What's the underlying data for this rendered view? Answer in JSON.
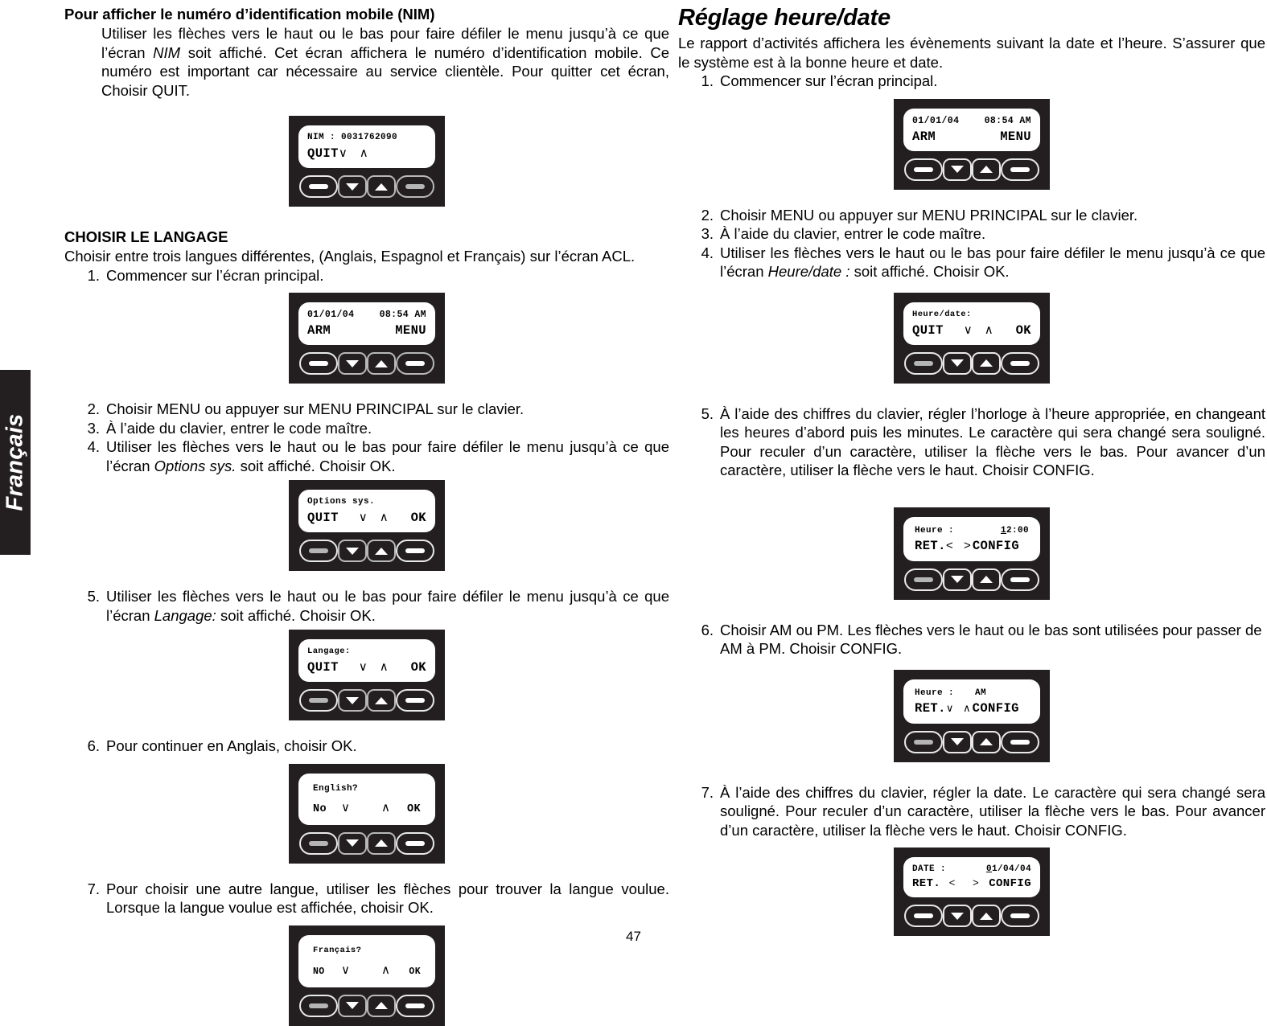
{
  "page": {
    "number": "47",
    "side_tab_label": "Français"
  },
  "left_column": {
    "section1": {
      "heading": "Pour afficher le numéro d’identification mobile (NIM)",
      "paragraph_part1": "Utiliser les flèches vers le haut ou le bas pour faire défiler le menu jusqu’à ce que l’écran ",
      "paragraph_italic": "NIM",
      "paragraph_part2": " soit affiché. Cet écran affichera le numéro d’identification mobile. Ce numéro est important car nécessaire au service clientèle. Pour quitter cet écran, Choisir QUIT."
    },
    "device_nim": {
      "line1_left": "NIM : 0031762090",
      "line1_right": "",
      "line2_left": "QUIT",
      "line2_arrows": "∨ ∧",
      "line2_right": "",
      "buttons": [
        "soft-left-button",
        "down-arrow-button",
        "up-arrow-button",
        "soft-right-button"
      ]
    },
    "section2": {
      "heading": "CHOISIR LE LANGAGE",
      "intro": "Choisir entre trois langues différentes, (Anglais, Espagnol et Français) sur l’écran ACL.",
      "steps": [
        {
          "num": "1.",
          "text": "Commencer sur l’écran principal."
        },
        {
          "num": "2.",
          "text": "Choisir MENU ou appuyer sur MENU PRINCIPAL sur le clavier."
        },
        {
          "num": "3.",
          "text": "À l’aide du clavier, entrer le code maître."
        },
        {
          "num": "4.",
          "pre": "Utiliser les flèches vers le haut ou le bas pour faire défiler le menu jusqu’à ce que l’écran ",
          "italic": "Options sys.",
          "post": " soit affiché. Choisir OK."
        },
        {
          "num": "5.",
          "pre": "Utiliser les flèches vers le haut ou le bas pour faire défiler le menu jusqu’à ce que l’écran ",
          "italic": "Langage:",
          "post": " soit affiché. Choisir OK."
        },
        {
          "num": "6.",
          "text": "Pour continuer en Anglais, choisir OK."
        },
        {
          "num": "7.",
          "text": "Pour choisir une autre langue, utiliser les flèches pour trouver la langue voulue. Lorsque la langue voulue est affichée, choisir OK."
        }
      ]
    },
    "device_main_screen": {
      "line1_left": "01/01/04",
      "line1_right": "08:54 AM",
      "line2_left": "ARM",
      "line2_right": "MENU"
    },
    "device_options_sys": {
      "line1_left": "Options sys.",
      "line2_left": "QUIT",
      "line2_arrows": "∨ ∧",
      "line2_right": "OK"
    },
    "device_langage": {
      "line1_left": "Langage:",
      "line2_left": "QUIT",
      "line2_arrows": "∨ ∧",
      "line2_right": "OK"
    },
    "device_english": {
      "line1_left": "English?",
      "line2_left": "No",
      "line2_arrows": "∨   ∧",
      "line2_right": "OK"
    },
    "device_francais": {
      "line1_left": "Français?",
      "line2_left": "NO",
      "line2_arrows": "∨   ∧",
      "line2_right": "OK"
    }
  },
  "right_column": {
    "title": "Réglage heure/date",
    "intro": "Le rapport d’activités affichera les évènements suivant la date et l’heure. S’assurer que le système est à la bonne heure et date.",
    "steps": [
      {
        "num": "1.",
        "text": "Commencer sur l’écran principal."
      },
      {
        "num": "2.",
        "text": "Choisir MENU ou appuyer sur MENU PRINCIPAL sur le clavier."
      },
      {
        "num": "3.",
        "text": "À l’aide du clavier, entrer le code maître."
      },
      {
        "num": "4.",
        "pre": "Utiliser les flèches vers le haut ou le bas pour faire défiler le menu jusqu’à ce que l’écran ",
        "italic": "Heure/date :",
        "post": " soit affiché. Choisir OK."
      },
      {
        "num": "5.",
        "text": "À l’aide des chiffres du clavier, régler l’horloge à l’heure appropriée, en changeant les heures d’abord puis les minutes. Le caractère qui sera changé sera souligné. Pour reculer d’un caractère, utiliser la flèche vers le bas. Pour avancer d’un caractère, utiliser la flèche vers le haut. Choisir CONFIG."
      },
      {
        "num": "6.",
        "text": "Choisir AM ou PM. Les flèches vers le haut ou le bas sont utilisées pour passer de AM à PM. Choisir CONFIG."
      },
      {
        "num": "7.",
        "text": "À l’aide des chiffres du clavier, régler la date. Le caractère qui sera changé sera souligné. Pour reculer d’un caractère, utiliser la flèche vers le bas. Pour avancer d’un caractère, utiliser la flèche vers le haut. Choisir CONFIG."
      }
    ],
    "device_main_screen": {
      "line1_left": "01/01/04",
      "line1_right": "08:54 AM",
      "line2_left": "ARM",
      "line2_right": "MENU"
    },
    "device_heure_date": {
      "line1_left": "Heure/date:",
      "line2_left": "QUIT",
      "line2_arrows": "∨ ∧",
      "line2_right": "OK"
    },
    "device_heure_time": {
      "line1_label": "Heure :",
      "line1_value_underlined": "1",
      "line1_value_rest": "2:00",
      "line2_left": "RET.",
      "line2_arrows": "< >",
      "line2_right": "CONFIG"
    },
    "device_heure_ampm": {
      "line1_label": "Heure :",
      "line1_value": "AM",
      "line2_left": "RET.",
      "line2_arrows": "∨ ∧",
      "line2_right": "CONFIG"
    },
    "device_date": {
      "line1_label": "DATE :",
      "line1_value_underlined": "0",
      "line1_value_rest": "1/04/04",
      "line2_left": "RET.",
      "line2_arrows": "<  >",
      "line2_right": "CONFIG"
    }
  },
  "colors": {
    "device_body": "#231f20",
    "lcd_background": "#ffffff",
    "button_border": "#e9e9e9",
    "button_border_dim": "#b8b8b8",
    "bar_white": "#ffffff",
    "bar_gray": "#b5b5b5"
  }
}
